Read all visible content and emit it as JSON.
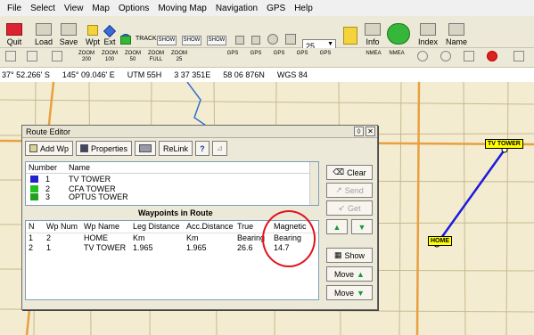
{
  "menu": [
    "File",
    "Select",
    "View",
    "Map",
    "Options",
    "Moving Map",
    "Navigation",
    "GPS",
    "Help"
  ],
  "toolbar": {
    "quit": "Quit",
    "load": "Load",
    "save": "Save",
    "wpt": "Wpt",
    "ext": "Ext",
    "track": "TRACK",
    "show": "SHOW",
    "zoom_value": "25",
    "info": "Info",
    "index": "Index",
    "name": "Name"
  },
  "toolbar2": [
    "ZOOM 200",
    "ZOOM 100",
    "ZOOM 50",
    "ZOOM FULL",
    "ZOOM 25",
    "GPS",
    "GPS",
    "GPS",
    "GPS",
    "GPS",
    "NMEA",
    "NMEA"
  ],
  "status": {
    "lat": "37° 52.266' S",
    "lon": "145° 09.046' E",
    "utm": "UTM  55H",
    "easting": "3 37 351E",
    "northing": "58 06 876N",
    "datum": "WGS 84"
  },
  "map": {
    "waypoint_labels": [
      "TV TOWER",
      "HOME"
    ],
    "route_color": "#1a1adc",
    "annotation_color": "#e0141c"
  },
  "dialog": {
    "title": "Route Editor",
    "toolbar": {
      "add_wp": "Add Wp",
      "properties": "Properties",
      "relink": "ReLink",
      "help": "?"
    },
    "route_list": {
      "headers": [
        "Number",
        "Name"
      ],
      "rows": [
        {
          "number": "1",
          "name": "TV TOWER",
          "color": "#2020d0"
        },
        {
          "number": "2",
          "name": "CFA TOWER",
          "color": "#20c020"
        },
        {
          "number": "3",
          "name": "OPTUS TOWER",
          "color": "#20a020"
        }
      ]
    },
    "waypoints_title": "Waypoints in Route",
    "waypoints": {
      "headers": [
        "N",
        "Wp Num",
        "Wp Name",
        "Leg Distance",
        "Acc.Distance",
        "True",
        "Magnetic"
      ],
      "rows": [
        [
          "1",
          "2",
          "HOME",
          "Km",
          "Km",
          "Bearing",
          "Bearing"
        ],
        [
          "2",
          "1",
          "TV TOWER",
          "1.965",
          "1.965",
          "26.6",
          "14.7"
        ]
      ]
    },
    "side_buttons": {
      "clear": "Clear",
      "send": "Send",
      "get": "Get",
      "show": "Show",
      "move_up": "Move",
      "move_down": "Move"
    }
  }
}
